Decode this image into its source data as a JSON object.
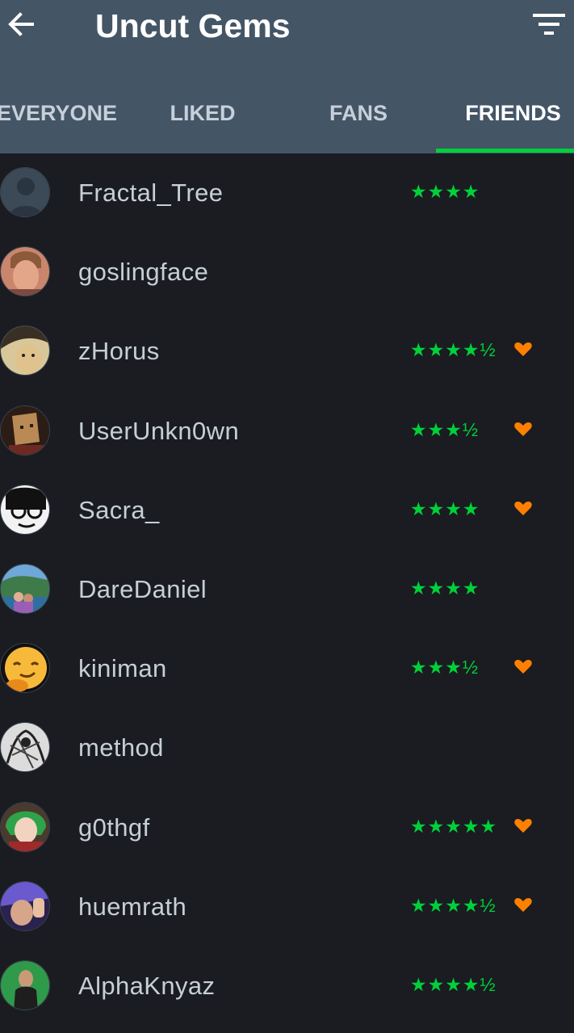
{
  "header": {
    "title": "Uncut Gems",
    "back_icon": "arrow-left-icon",
    "filter_icon": "filter-icon"
  },
  "tabs": [
    {
      "label": "EVERYONE",
      "active": false
    },
    {
      "label": "LIKED",
      "active": false
    },
    {
      "label": "FANS",
      "active": false
    },
    {
      "label": "FRIENDS",
      "active": true
    }
  ],
  "colors": {
    "header_bg": "#445566",
    "list_bg": "#1a1c21",
    "accent_green": "#00d13a",
    "like_orange": "#ff8000"
  },
  "friends": [
    {
      "name": "Fractal_Tree",
      "rating": "★★★★",
      "liked": false
    },
    {
      "name": "goslingface",
      "rating": "",
      "liked": false
    },
    {
      "name": "zHorus",
      "rating": "★★★★½",
      "liked": true
    },
    {
      "name": "UserUnkn0wn",
      "rating": "★★★½",
      "liked": true
    },
    {
      "name": "Sacra_",
      "rating": "★★★★",
      "liked": true
    },
    {
      "name": "DareDaniel",
      "rating": "★★★★",
      "liked": false
    },
    {
      "name": "kiniman",
      "rating": "★★★½",
      "liked": true
    },
    {
      "name": "method",
      "rating": "",
      "liked": false
    },
    {
      "name": "g0thgf",
      "rating": "★★★★★",
      "liked": true
    },
    {
      "name": "huemrath",
      "rating": "★★★★½",
      "liked": true
    },
    {
      "name": "AlphaKnyaz",
      "rating": "★★★★½",
      "liked": false
    }
  ]
}
